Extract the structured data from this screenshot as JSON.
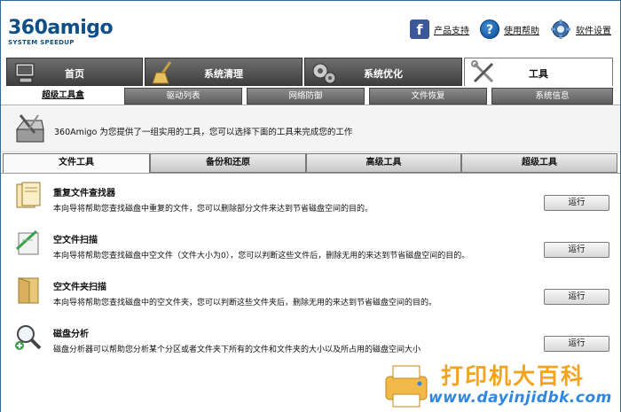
{
  "app": {
    "logo_main": "360amigo",
    "logo_sub": "SYSTEM SPEEDUP"
  },
  "header_links": [
    {
      "label": "产品支持",
      "icon": "facebook-icon"
    },
    {
      "label": "使用帮助",
      "icon": "help-icon"
    },
    {
      "label": "软件设置",
      "icon": "gear-icon"
    }
  ],
  "main_tabs": [
    {
      "label": "首页",
      "icon": "home-computer-icon",
      "active": false
    },
    {
      "label": "系统清理",
      "icon": "broom-icon",
      "active": false
    },
    {
      "label": "系统优化",
      "icon": "gears-icon",
      "active": false
    },
    {
      "label": "工具",
      "icon": "wrench-screwdriver-icon",
      "active": true
    }
  ],
  "sub_tabs": [
    {
      "label": "超级工具盒",
      "active": true
    },
    {
      "label": "驱动列表",
      "active": false
    },
    {
      "label": "网络防御",
      "active": false
    },
    {
      "label": "文件恢复",
      "active": false
    },
    {
      "label": "系统信息",
      "active": false
    }
  ],
  "intro": {
    "text": "360Amigo 为您提供了一组实用的工具，您可以选择下面的工具来完成您的工作",
    "icon": "toolbox-icon"
  },
  "tool_tabs": [
    {
      "label": "文件工具",
      "active": true
    },
    {
      "label": "备份和还原",
      "active": false
    },
    {
      "label": "高级工具",
      "active": false
    },
    {
      "label": "超级工具",
      "active": false
    }
  ],
  "tools": [
    {
      "title": "重复文件查找器",
      "desc": "本向导将帮助您查找磁盘中重复的文件，您可以删除部分文件来达到节省磁盘空间的目的。",
      "button": "运行",
      "icon": "duplicate-files-icon"
    },
    {
      "title": "空文件扫描",
      "desc": "本向导将帮助您查找磁盘中空文件（文件大小为0），您可以判断这些文件后，删除无用的来达到节省磁盘空间的目的。",
      "button": "运行",
      "icon": "empty-file-icon"
    },
    {
      "title": "空文件夹扫描",
      "desc": "本向导将帮助您查找磁盘中的空文件夹，您可以判断这些文件夹后，删除无用的来达到节省磁盘空间的目的。",
      "button": "运行",
      "icon": "empty-folder-icon"
    },
    {
      "title": "磁盘分析",
      "desc": "磁盘分析器可以帮助您分析某个分区或者文件夹下所有的文件和文件夹的大小以及所占用的磁盘空间大小",
      "button": "运行",
      "icon": "disk-analysis-icon"
    }
  ],
  "watermark": {
    "line1": "打印机大百科",
    "line2": "www.dayinjidbk.com"
  }
}
